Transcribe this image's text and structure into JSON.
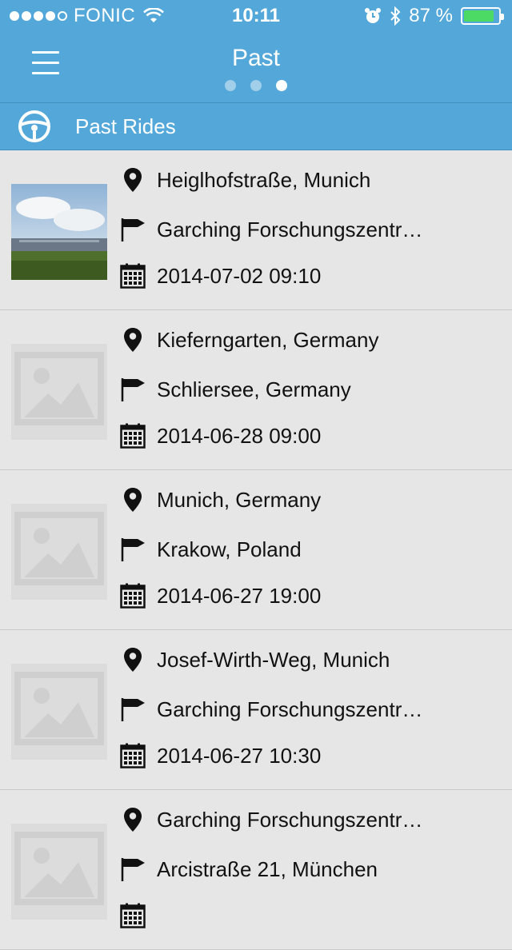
{
  "status": {
    "carrier": "FONIC",
    "time": "10:11",
    "battery": "87 %",
    "signal_bars": 4
  },
  "nav": {
    "title": "Past",
    "pages": 3,
    "active_page": 3
  },
  "section": {
    "title": "Past Rides",
    "icon": "steering-wheel-icon"
  },
  "rides": [
    {
      "from": "Heiglhofstraße, Munich",
      "to": "Garching Forschungszentr…",
      "date": "2014-07-02 09:10",
      "has_photo": true
    },
    {
      "from": "Kieferngarten, Germany",
      "to": "Schliersee, Germany",
      "date": "2014-06-28 09:00",
      "has_photo": false
    },
    {
      "from": "Munich, Germany",
      "to": "Krakow, Poland",
      "date": "2014-06-27 19:00",
      "has_photo": false
    },
    {
      "from": "Josef-Wirth-Weg, Munich",
      "to": "Garching Forschungszentr…",
      "date": "2014-06-27 10:30",
      "has_photo": false
    },
    {
      "from": "Garching Forschungszentr…",
      "to": "Arcistraße 21, München",
      "date": "",
      "has_photo": false
    }
  ],
  "colors": {
    "header": "#54a8d9",
    "background": "#e6e6e6",
    "battery": "#4cd964"
  }
}
